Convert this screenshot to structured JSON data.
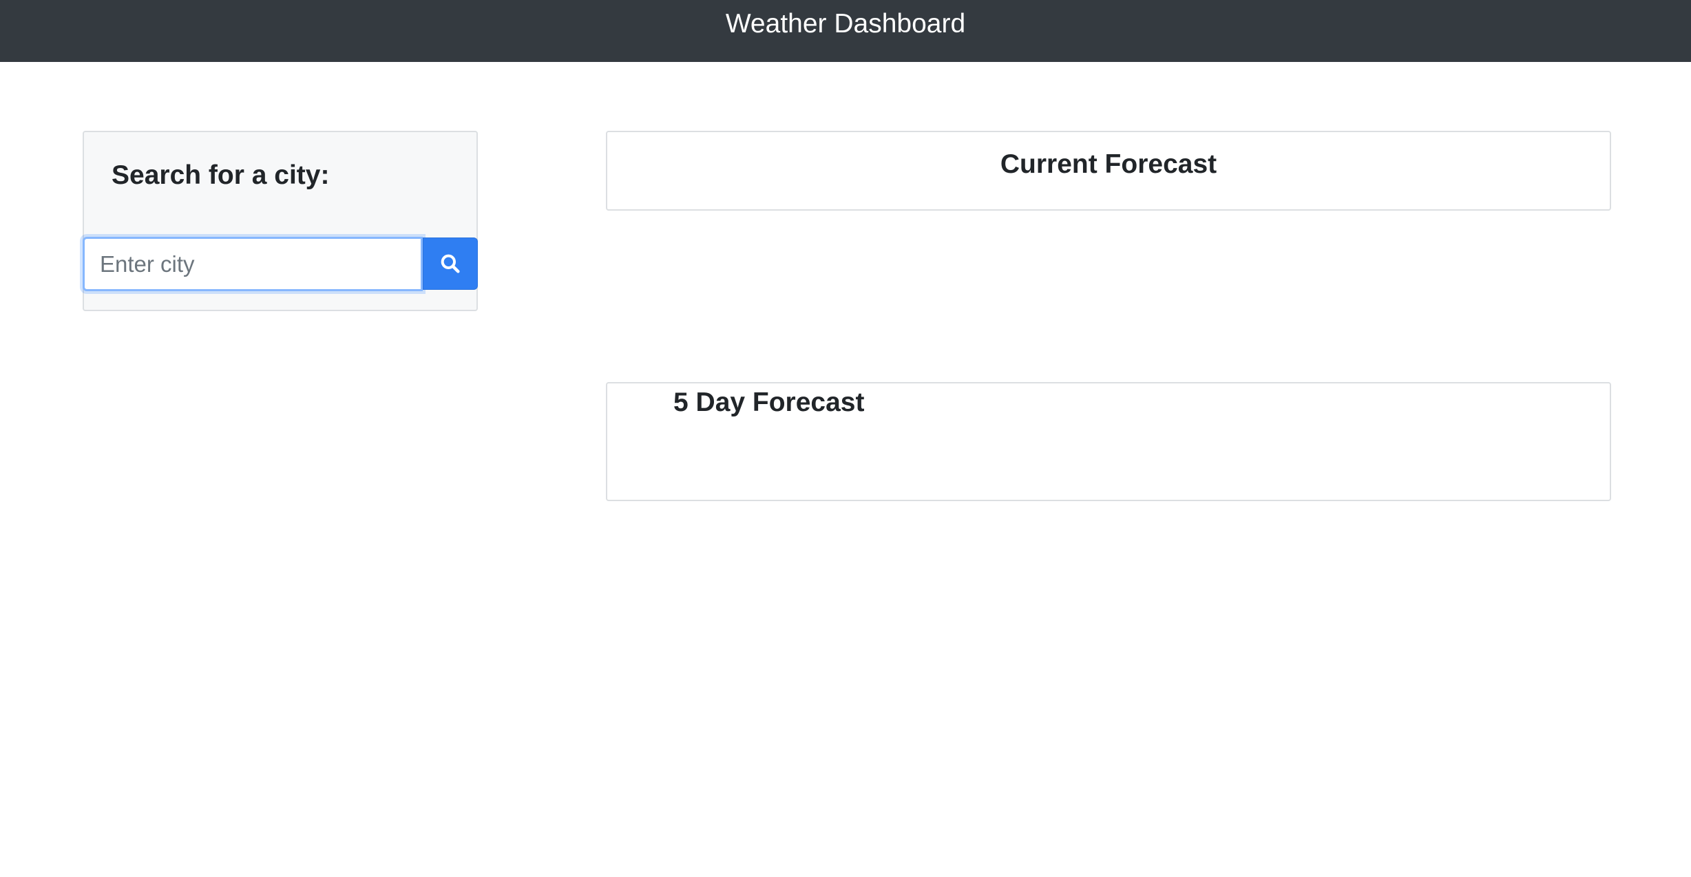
{
  "navbar": {
    "title": "Weather Dashboard"
  },
  "search": {
    "heading": "Search for a city:",
    "input_value": "",
    "placeholder": "Enter city",
    "button_icon": "search-icon",
    "button_color": "#2f7ef2"
  },
  "current_forecast": {
    "title": "Current Forecast"
  },
  "five_day_forecast": {
    "title": "5 Day Forecast"
  },
  "colors": {
    "navbar_bg": "#343a40",
    "accent": "#2f7ef2"
  }
}
